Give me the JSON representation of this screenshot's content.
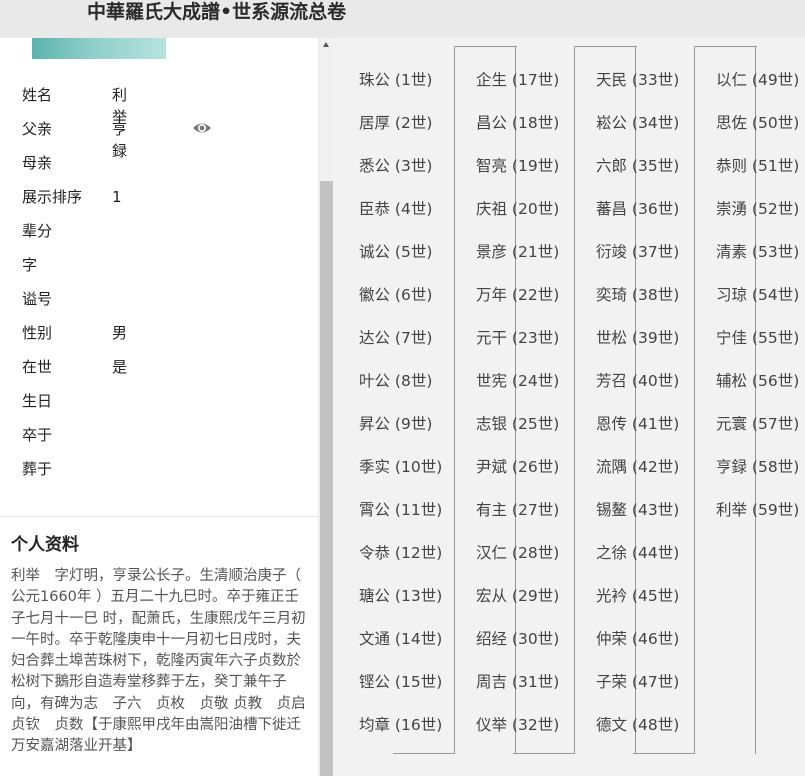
{
  "header": {
    "title": "中華羅氏大成譜•世系源流总卷"
  },
  "profile": {
    "fields": [
      {
        "label": "姓名",
        "value": "利举"
      },
      {
        "label": "父亲",
        "value": "亨録"
      },
      {
        "label": "母亲",
        "value": ""
      },
      {
        "label": "展示排序",
        "value": "1"
      },
      {
        "label": "辈分",
        "value": ""
      },
      {
        "label": "字",
        "value": ""
      },
      {
        "label": "谥号",
        "value": ""
      },
      {
        "label": "性别",
        "value": "男"
      },
      {
        "label": "在世",
        "value": "是"
      },
      {
        "label": "生日",
        "value": ""
      },
      {
        "label": "卒于",
        "value": ""
      },
      {
        "label": "葬于",
        "value": ""
      }
    ],
    "father_icon": "eye-icon",
    "section_title": "个人资料",
    "bio": "利举　字灯明，亨录公长子。生清顺治庚子（ 公元1660年 ）五月二十九巳时。卒于雍正壬子七月十一巳 时，配萧氏，生康熙戊午三月初一午时。卒于乾隆庚申十一月初七日戌时，夫妇合葬土埠苦珠树下，乾隆丙寅年六子贞数於松树下鵝形自造寿堂移葬于左，癸丁兼午子向，有碑为志　子六　贞枚　贞敬 贞教　贞启　贞钦　贞数【于康熙甲戌年由嵩阳油槽下徙迁万安嘉湖落业开基】"
  },
  "lineage": {
    "columns": [
      [
        "珠公 (1世)",
        "居厚 (2世)",
        "悉公 (3世)",
        "臣恭 (4世)",
        "诚公 (5世)",
        "徽公 (6世)",
        "达公 (7世)",
        "叶公 (8世)",
        "昇公 (9世)",
        "季实 (10世)",
        "霄公 (11世)",
        "令恭 (12世)",
        "瑭公 (13世)",
        "文通 (14世)",
        "铿公 (15世)",
        "均章 (16世)"
      ],
      [
        "企生 (17世)",
        "昌公 (18世)",
        "智亮 (19世)",
        "庆祖 (20世)",
        "景彦 (21世)",
        "万年 (22世)",
        "元干 (23世)",
        "世宪 (24世)",
        "志银 (25世)",
        "尹斌 (26世)",
        "有主 (27世)",
        "汉仁 (28世)",
        "宏从 (29世)",
        "绍经 (30世)",
        "周吉 (31世)",
        "仪举 (32世)"
      ],
      [
        "天民 (33世)",
        "崧公 (34世)",
        "六郎 (35世)",
        "蕃昌 (36世)",
        "衍竣 (37世)",
        "奕琦 (38世)",
        "世松 (39世)",
        "芳召 (40世)",
        "恩传 (41世)",
        "流隅 (42世)",
        "锡鳌 (43世)",
        "之徐 (44世)",
        "光衿 (45世)",
        "仲荣 (46世)",
        "子荣 (47世)",
        "德文 (48世)"
      ],
      [
        "以仁 (49世)",
        "思佐 (50世)",
        "恭则 (51世)",
        "崇湧 (52世)",
        "清素 (53世)",
        "习琼 (54世)",
        "宁佳 (55世)",
        "辅松 (56世)",
        "元寰 (57世)",
        "亨録 (58世)",
        "利举 (59世)"
      ]
    ]
  }
}
